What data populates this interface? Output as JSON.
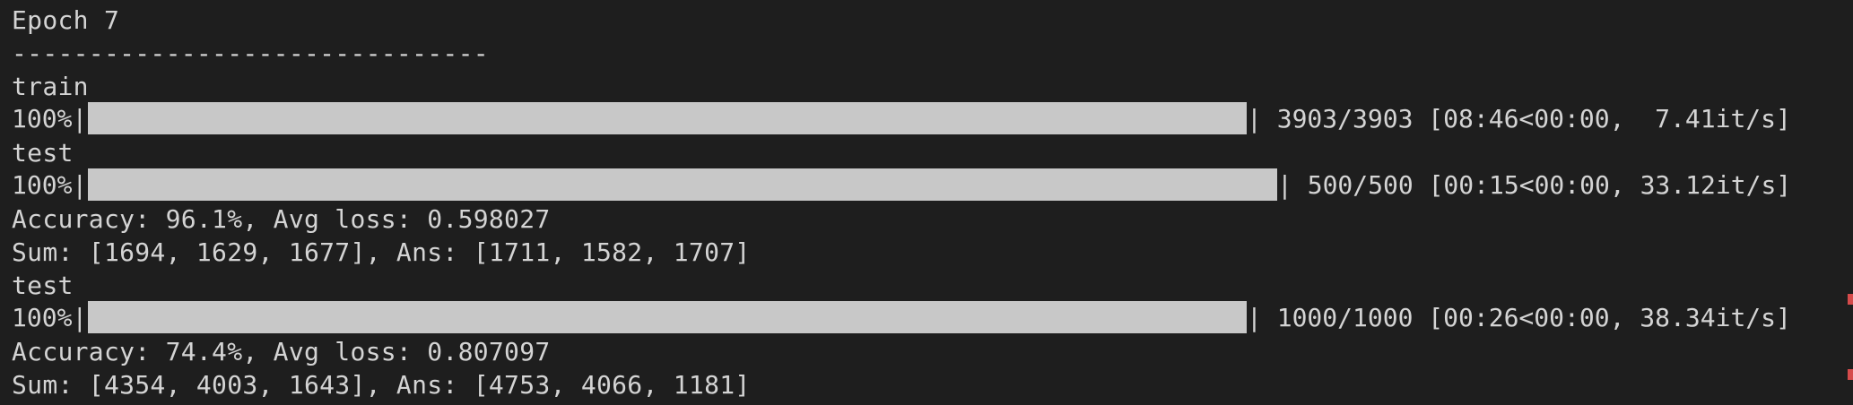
{
  "terminal": {
    "epoch_header": "Epoch 7",
    "divider": "-------------------------------",
    "sections": [
      {
        "phase": "train",
        "progress": {
          "percent_label": "100%|",
          "fraction": 1.0,
          "stats": "| 3903/3903 [08:46<00:00,  7.41it/s]"
        }
      },
      {
        "phase": "test",
        "progress": {
          "percent_label": "100%|",
          "fraction": 1.0,
          "stats": "| 500/500 [00:15<00:00, 33.12it/s]"
        },
        "accuracy_line": "Accuracy: 96.1%, Avg loss: 0.598027",
        "sum_line": "Sum: [1694, 1629, 1677], Ans: [1711, 1582, 1707]"
      },
      {
        "phase": "test",
        "progress": {
          "percent_label": "100%|",
          "fraction": 1.0,
          "stats": "| 1000/1000 [00:26<00:00, 38.34it/s]"
        },
        "accuracy_line": "Accuracy: 74.4%, Avg loss: 0.807097",
        "sum_line": "Sum: [4354, 4003, 1643], Ans: [4753, 4066, 1181]"
      }
    ]
  },
  "colors": {
    "background": "#1e1e1e",
    "text": "#d4d4d4",
    "progress_fill": "#c8c8c8",
    "scroll_marker": "#d64b4b"
  }
}
